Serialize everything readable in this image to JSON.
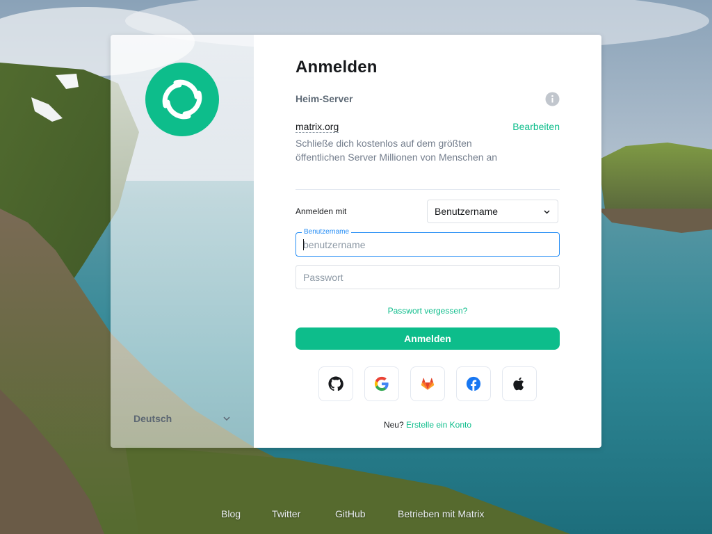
{
  "auth": {
    "title": "Anmelden",
    "homeserver_label": "Heim-Server",
    "server_name": "matrix.org",
    "edit_label": "Bearbeiten",
    "server_description": "Schließe dich kostenlos auf dem größten öffentlichen Server Millionen von Menschen an",
    "login_with_label": "Anmelden mit",
    "login_with_value": "Benutzername",
    "username_label": "Benutzername",
    "username_placeholder": "benutzername",
    "username_value": "",
    "password_placeholder": "Passwort",
    "password_value": "",
    "forgot_password": "Passwort vergessen?",
    "submit_label": "Anmelden",
    "sso_providers": [
      "github-icon",
      "google-icon",
      "gitlab-icon",
      "facebook-icon",
      "apple-icon"
    ],
    "register_prefix": "Neu?",
    "register_link": "Erstelle ein Konto"
  },
  "sidebar": {
    "language": "Deutsch"
  },
  "footer": {
    "links": [
      "Blog",
      "Twitter",
      "GitHub",
      "Betrieben mit Matrix"
    ]
  },
  "colors": {
    "accent": "#0dbd8b",
    "focus": "#238cf5",
    "text": "#17191c",
    "secondary_text": "#737d8c"
  }
}
